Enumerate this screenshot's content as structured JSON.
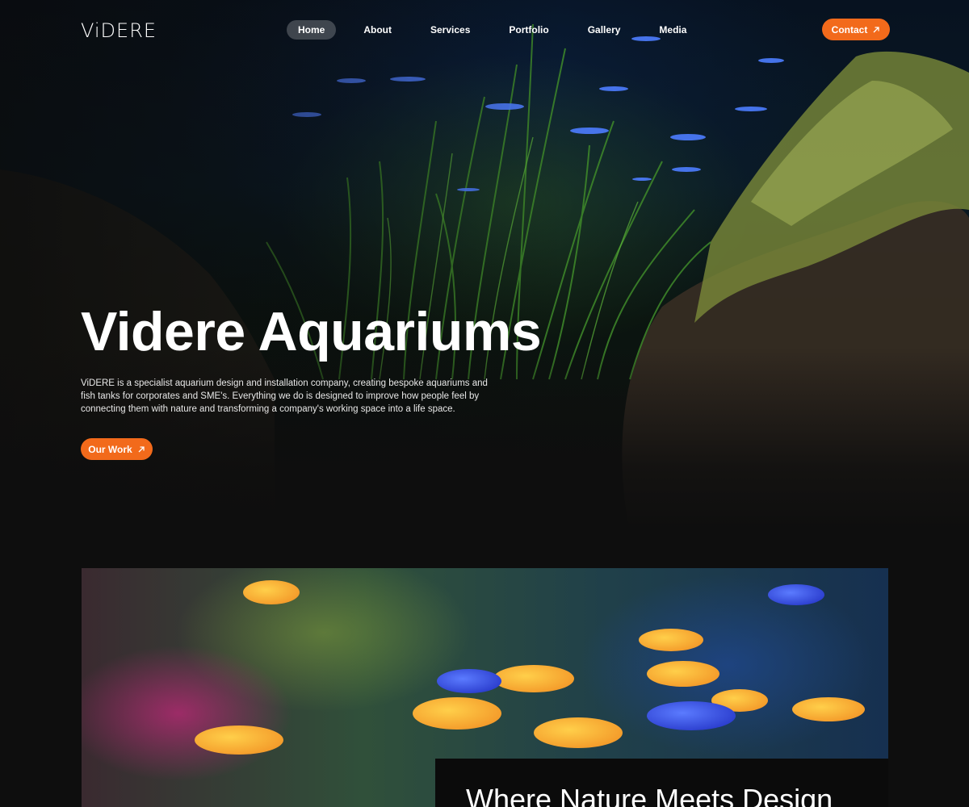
{
  "header": {
    "logo": "ViDERE",
    "nav": [
      "Home",
      "About",
      "Services",
      "Portfolio",
      "Gallery",
      "Media"
    ],
    "active": "Home",
    "contact_label": "Contact"
  },
  "hero": {
    "title": "Videre Aquariums",
    "description": "ViDERE is a specialist aquarium design and installation company, creating bespoke aquariums and fish tanks for corporates and SME's. Everything we do is designed to improve how people feel by connecting them with nature and transforming a company's working space into a life space.",
    "cta_label": "Our Work",
    "image": "aquarium-plants-and-fish-photo"
  },
  "feature": {
    "image": "colorful-cichlids-aquarium-photo",
    "caption": "Where Nature Meets Design"
  },
  "colors": {
    "accent": "#f26a1b",
    "background": "#0e0e0e"
  },
  "icons": {
    "arrow": "arrow-up-right-icon"
  }
}
